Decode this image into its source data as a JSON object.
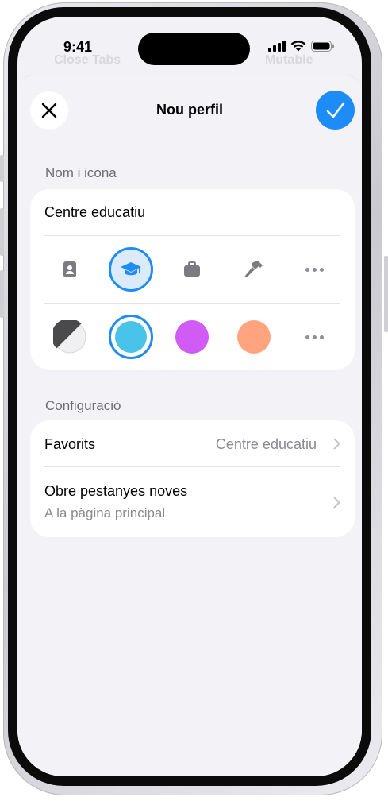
{
  "status_bar": {
    "time": "9:41",
    "icons": [
      "cellular-signal-icon",
      "wifi-icon",
      "battery-icon"
    ]
  },
  "background": {
    "left_title": "Close Tabs",
    "right_title": "Mutable"
  },
  "sheet": {
    "title": "Nou perfil",
    "close_icon": "close-icon",
    "done_icon": "checkmark-icon"
  },
  "name_section": {
    "header": "Nom i icona",
    "name_value": "Centre educatiu",
    "icons": [
      {
        "name": "id-badge-icon",
        "selected": false
      },
      {
        "name": "graduation-cap-icon",
        "selected": true
      },
      {
        "name": "briefcase-icon",
        "selected": false
      },
      {
        "name": "hammer-icon",
        "selected": false
      },
      {
        "name": "more-icon",
        "selected": false
      }
    ],
    "colors": [
      {
        "name": "auto-color",
        "value": "#4a4a4c",
        "selected": false
      },
      {
        "name": "cyan-color",
        "value": "#4ac3ea",
        "selected": true
      },
      {
        "name": "purple-color",
        "value": "#d15cf5",
        "selected": false
      },
      {
        "name": "orange-color",
        "value": "#ffa47e",
        "selected": false
      },
      {
        "name": "more-colors",
        "value": "#8e8e93",
        "selected": false
      }
    ]
  },
  "settings_section": {
    "header": "Configuració",
    "favorites_label": "Favorits",
    "favorites_value": "Centre educatiu",
    "new_tabs_label": "Obre pestanyes noves",
    "new_tabs_value": "A la pàgina principal"
  },
  "colors": {
    "accent": "#1d8cf7",
    "background": "#f2f2f7",
    "secondary_text": "#8a8a8e"
  }
}
